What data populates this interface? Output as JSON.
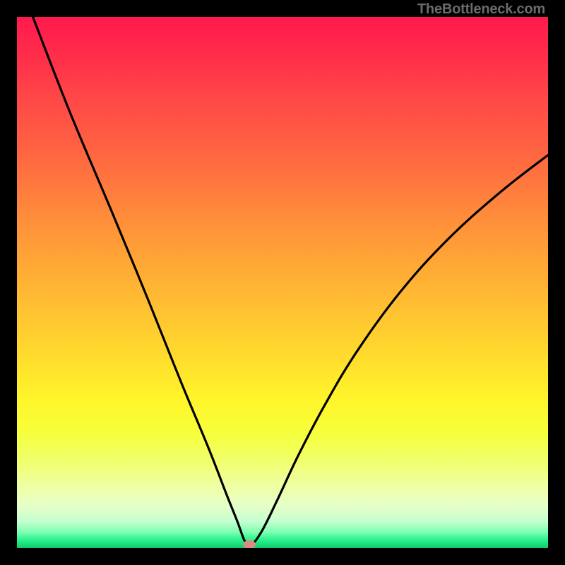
{
  "watermark": "TheBottleneck.com",
  "chart_data": {
    "type": "line",
    "title": "",
    "xlabel": "",
    "ylabel": "",
    "xlim": [
      0,
      100
    ],
    "ylim": [
      0,
      100
    ],
    "grid": false,
    "series": [
      {
        "name": "bottleneck-curve",
        "x": [
          3,
          10,
          18,
          25,
          31,
          36,
          39.5,
          41.5,
          42.8,
          43.8,
          46,
          49,
          53,
          58,
          64,
          72,
          81,
          91,
          100
        ],
        "y": [
          100,
          82,
          63,
          46,
          31,
          19,
          10,
          5,
          1.5,
          0.3,
          3,
          9,
          17.5,
          27,
          37,
          48,
          58,
          67,
          74
        ]
      }
    ],
    "annotations": [
      {
        "name": "min-marker",
        "x": 43.8,
        "y": 0.6,
        "color": "#d98d82"
      }
    ],
    "background_gradient": {
      "top": "#ff1a4d",
      "mid": "#ffe62a",
      "bottom": "#18d877"
    }
  }
}
